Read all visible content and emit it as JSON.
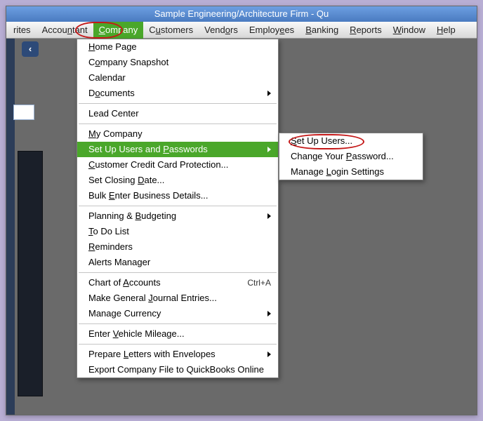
{
  "title": "Sample Engineering/Architecture Firm  - Qu",
  "menubar": {
    "items": [
      {
        "pre": "",
        "u": "",
        "post": "rites"
      },
      {
        "pre": "Accou",
        "u": "n",
        "post": "tant"
      },
      {
        "pre": "",
        "u": "C",
        "post": "ompany"
      },
      {
        "pre": "C",
        "u": "u",
        "post": "stomers"
      },
      {
        "pre": "Vend",
        "u": "o",
        "post": "rs"
      },
      {
        "pre": "Employ",
        "u": "e",
        "post": "es"
      },
      {
        "pre": "",
        "u": "B",
        "post": "anking"
      },
      {
        "pre": "",
        "u": "R",
        "post": "eports"
      },
      {
        "pre": "",
        "u": "W",
        "post": "indow"
      },
      {
        "pre": "",
        "u": "H",
        "post": "elp"
      }
    ],
    "active_index": 2
  },
  "dropdown": {
    "groups": [
      [
        {
          "pre": "",
          "u": "H",
          "post": "ome Page"
        },
        {
          "pre": "C",
          "u": "o",
          "post": "mpany Snapshot"
        },
        {
          "pre": "Calendar",
          "u": "",
          "post": ""
        },
        {
          "pre": "D",
          "u": "o",
          "post": "cuments",
          "submenu": true
        }
      ],
      [
        {
          "pre": "Lead Center",
          "u": "",
          "post": ""
        }
      ],
      [
        {
          "pre": "",
          "u": "M",
          "post": "y Company"
        },
        {
          "pre": "Set Up Users and ",
          "u": "P",
          "post": "asswords",
          "submenu": true,
          "highlight": true
        },
        {
          "pre": "",
          "u": "C",
          "post": "ustomer Credit Card Protection..."
        },
        {
          "pre": "Set Closing ",
          "u": "D",
          "post": "ate..."
        },
        {
          "pre": "Bulk ",
          "u": "E",
          "post": "nter Business Details..."
        }
      ],
      [
        {
          "pre": "Planning & ",
          "u": "B",
          "post": "udgeting",
          "submenu": true
        },
        {
          "pre": "",
          "u": "T",
          "post": "o Do List"
        },
        {
          "pre": "",
          "u": "R",
          "post": "eminders"
        },
        {
          "pre": "Alerts Manager",
          "u": "",
          "post": ""
        }
      ],
      [
        {
          "pre": "Chart of ",
          "u": "A",
          "post": "ccounts",
          "shortcut": "Ctrl+A"
        },
        {
          "pre": "Make General ",
          "u": "J",
          "post": "ournal Entries..."
        },
        {
          "pre": "Manage Currency",
          "u": "",
          "post": "",
          "submenu": true
        }
      ],
      [
        {
          "pre": "Enter ",
          "u": "V",
          "post": "ehicle Mileage..."
        }
      ],
      [
        {
          "pre": "Prepare ",
          "u": "L",
          "post": "etters with Envelopes",
          "submenu": true
        },
        {
          "pre": "Export Company File to QuickBooks Online",
          "u": "",
          "post": ""
        }
      ]
    ]
  },
  "submenu": {
    "items": [
      {
        "pre": "",
        "u": "S",
        "post": "et Up Users...",
        "circle": true
      },
      {
        "pre": "Change Your ",
        "u": "P",
        "post": "assword..."
      },
      {
        "pre": "Manage ",
        "u": "L",
        "post": "ogin Settings"
      }
    ]
  },
  "back_glyph": "‹"
}
